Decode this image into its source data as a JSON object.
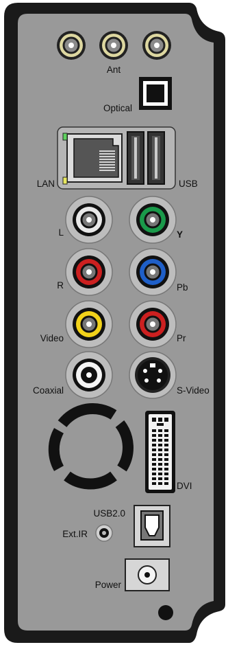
{
  "device": {
    "body_color": "#1a1a1a",
    "panel_color": "#999999",
    "port_colors": {
      "white": "#e8e8e8",
      "green": "#1a9a4a",
      "red": "#cc2020",
      "blue": "#1f5fc8",
      "yellow": "#f2d21a",
      "black": "#111111",
      "led_green": "#5fd35f",
      "led_yellow": "#e8e860"
    }
  },
  "labels": {
    "ant": "Ant",
    "optical": "Optical",
    "lan": "LAN",
    "usb": "USB",
    "l": "L",
    "y": "Y",
    "r": "R",
    "pb": "Pb",
    "video": "Video",
    "pr": "Pr",
    "coaxial": "Coaxial",
    "svideo": "S-Video",
    "dvi": "DVI",
    "usb20": "USB2.0",
    "extir": "Ext.IR",
    "power": "Power"
  },
  "icons": [
    "antenna-connector-icon",
    "optical-port-icon",
    "ethernet-port-icon",
    "usb-port-icon",
    "rca-jack-icon",
    "svideo-jack-icon",
    "fan-icon",
    "dvi-port-icon",
    "usb-b-port-icon",
    "ir-jack-icon",
    "dc-power-jack-icon",
    "screw-hole-icon"
  ]
}
